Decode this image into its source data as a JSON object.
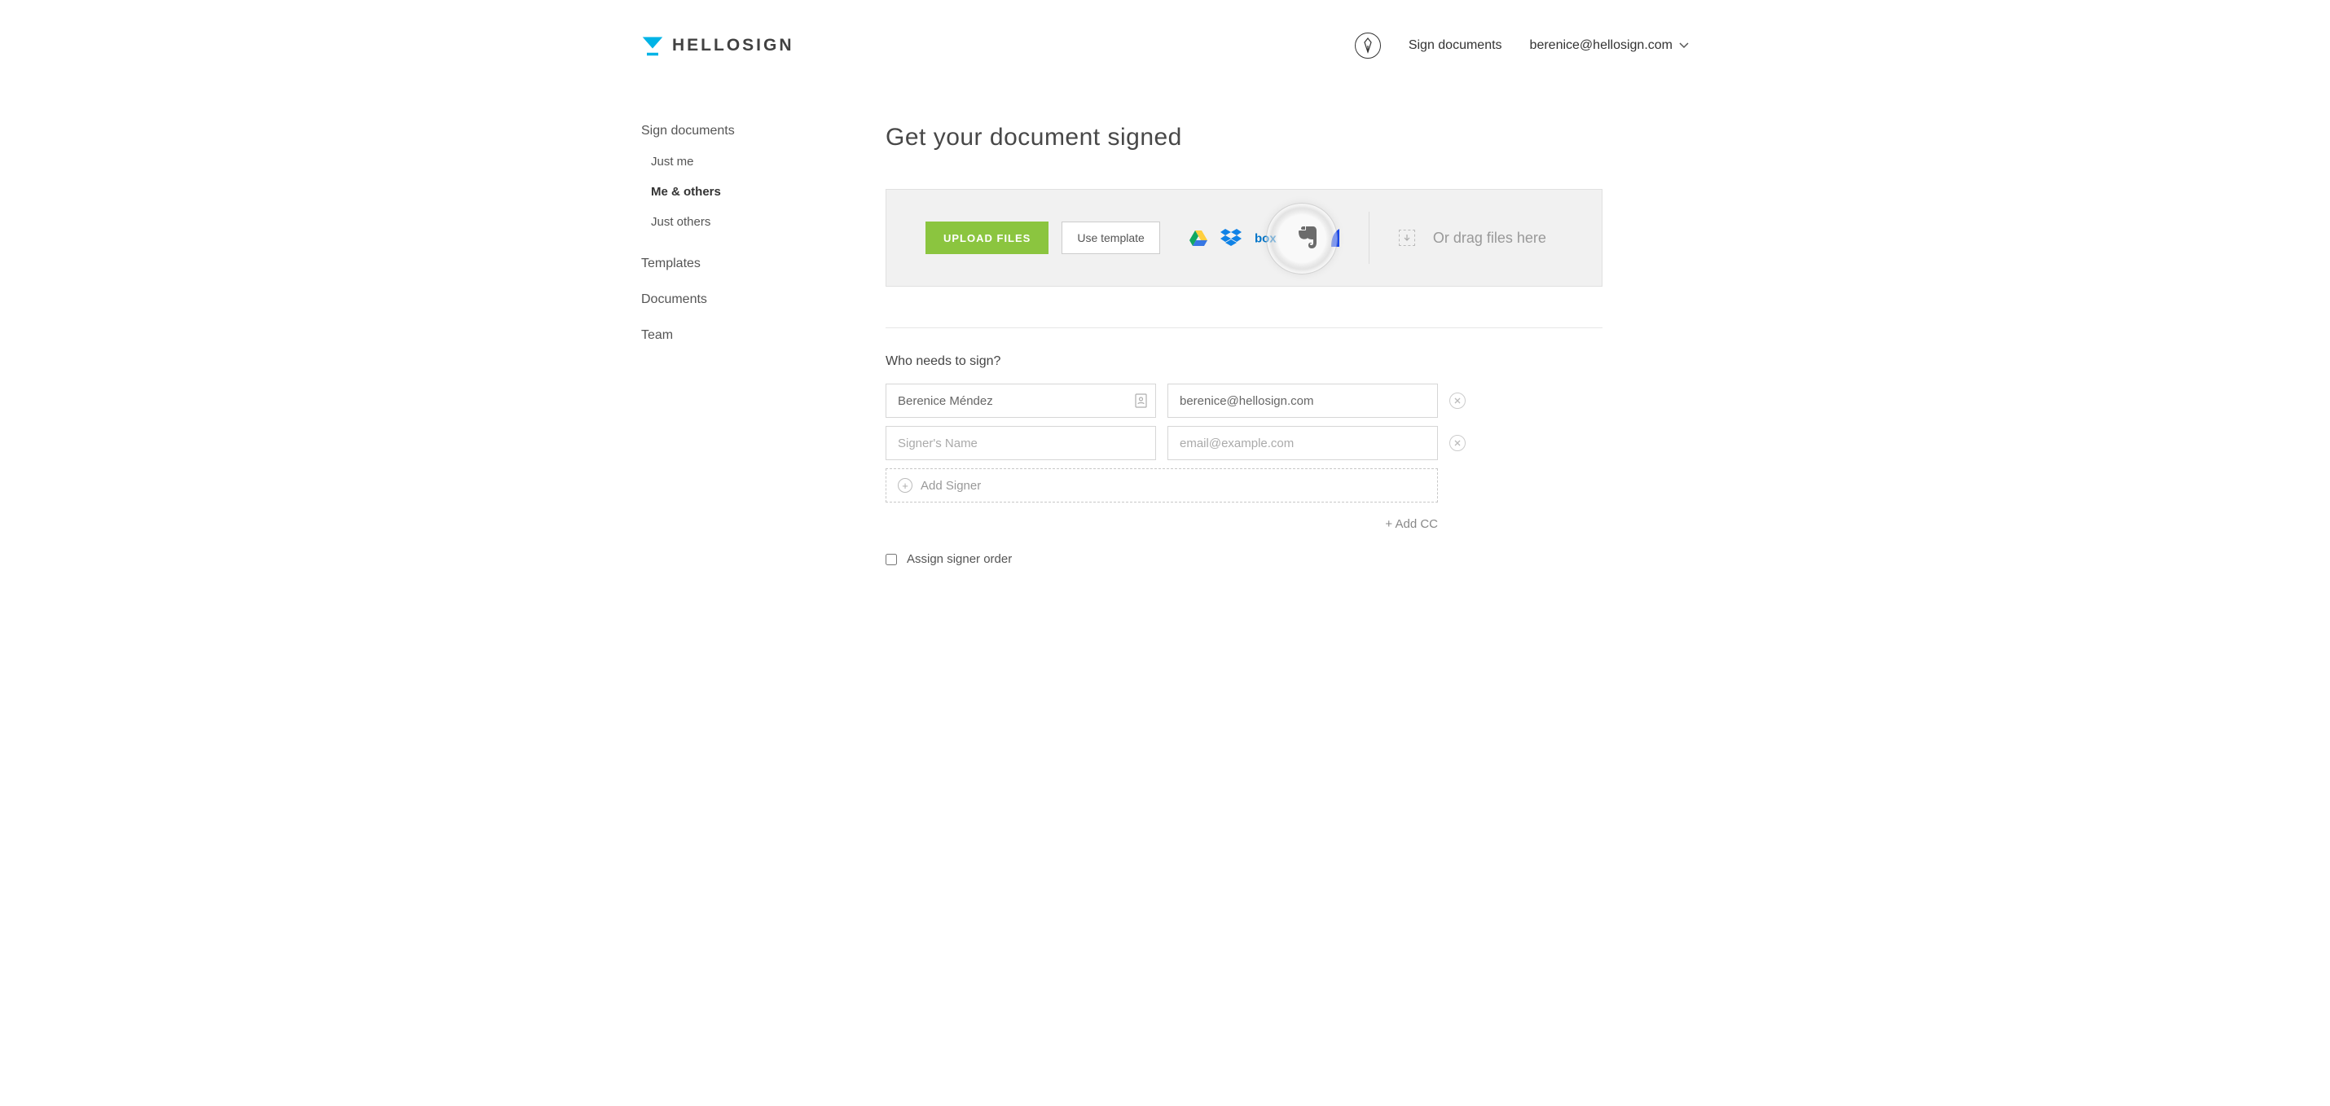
{
  "header": {
    "logo_text": "HELLOSIGN",
    "sign_link": "Sign documents",
    "user_email": "berenice@hellosign.com"
  },
  "sidebar": {
    "sign_documents": "Sign documents",
    "subs": [
      {
        "label": "Just me",
        "active": false
      },
      {
        "label": "Me & others",
        "active": true
      },
      {
        "label": "Just others",
        "active": false
      }
    ],
    "templates": "Templates",
    "documents": "Documents",
    "team": "Team"
  },
  "main": {
    "title": "Get your document signed",
    "upload_button": "UPLOAD FILES",
    "template_button": "Use template",
    "drag_text": "Or drag files here",
    "who_signs": "Who needs to sign?",
    "signers": [
      {
        "name": "Berenice Méndez",
        "email": "berenice@hellosign.com"
      },
      {
        "name": "",
        "email": ""
      }
    ],
    "name_placeholder": "Signer's Name",
    "email_placeholder": "email@example.com",
    "add_signer": "Add Signer",
    "add_cc": "+ Add CC",
    "assign_order": "Assign signer order"
  }
}
